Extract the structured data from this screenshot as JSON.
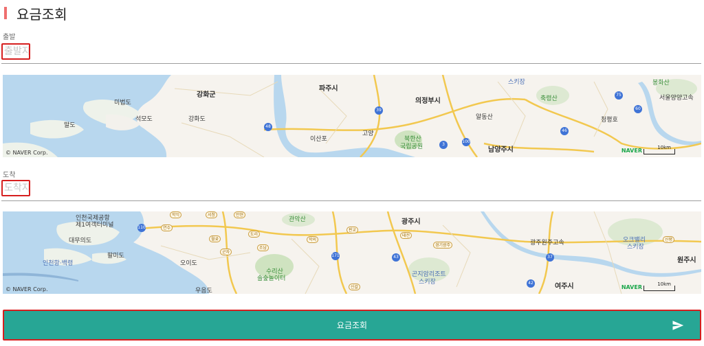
{
  "header": {
    "title": "요금조회"
  },
  "departure": {
    "label": "출발",
    "placeholder": "출발지"
  },
  "arrival": {
    "label": "도착",
    "placeholder": "도착지"
  },
  "map_common": {
    "copyright": "© NAVER Corp.",
    "logo": "NAVER",
    "scale": "10km"
  },
  "map1": {
    "places": [
      "강화군",
      "파주시",
      "의정부시",
      "미법도",
      "석모도",
      "강화도",
      "말도",
      "북한산",
      "국립공원",
      "알동산",
      "남양주시",
      "축령산",
      "청평호",
      "서울양양고속",
      "봉화산",
      "이산포",
      "고양",
      "스키장"
    ],
    "roads": [
      "39",
      "48",
      "3",
      "100",
      "75",
      "46",
      "60"
    ]
  },
  "map2": {
    "places": [
      "광주시",
      "인천국제공항",
      "제1여객터미널",
      "대무의도",
      "팔미도",
      "인천항·백령",
      "오이도",
      "수리산",
      "솔숲놀이터",
      "곤지암리조트",
      "스키장",
      "여주시",
      "원주시",
      "오크밸리",
      "스키장",
      "광주원주고속",
      "관악산",
      "우음도"
    ],
    "jc": [
      "학익",
      "서창",
      "안현",
      "연수",
      "도리",
      "월곶",
      "군자",
      "조남",
      "학의",
      "판교",
      "태전",
      "경기광주",
      "신평",
      "신갈"
    ],
    "roads": [
      "110",
      "171",
      "43",
      "37",
      "42"
    ]
  },
  "submit": {
    "label": "요금조회",
    "icon": "send-icon"
  },
  "colors": {
    "accent": "#27a695",
    "highlight": "#d61e1e",
    "title_bar": "#ef6f6f"
  }
}
